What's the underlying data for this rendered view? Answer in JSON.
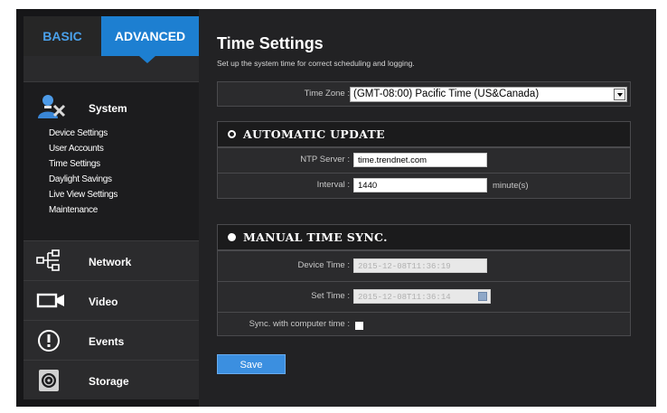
{
  "tabs": {
    "basic": "BASIC",
    "advanced": "ADVANCED"
  },
  "sidebar": {
    "system": {
      "label": "System",
      "items": [
        "Device Settings",
        "User Accounts",
        "Time Settings",
        "Daylight Savings",
        "Live View Settings",
        "Maintenance"
      ]
    },
    "network": "Network",
    "video": "Video",
    "events": "Events",
    "storage": "Storage"
  },
  "page": {
    "title": "Time Settings",
    "description": "Set up the system time for correct scheduling and logging."
  },
  "time_zone": {
    "label": "Time Zone :",
    "value": "(GMT-08:00) Pacific Time (US&Canada)"
  },
  "automatic_update": {
    "title": "AUTOMATIC UPDATE",
    "selected": false,
    "ntp_label": "NTP Server :",
    "ntp_value": "time.trendnet.com",
    "interval_label": "Interval :",
    "interval_value": "1440",
    "interval_unit": "minute(s)"
  },
  "manual_sync": {
    "title": "MANUAL TIME SYNC.",
    "selected": true,
    "device_time_label": "Device Time :",
    "device_time_value": "2015-12-08T11:36:19",
    "set_time_label": "Set Time :",
    "set_time_value": "2015-12-08T11:36:14",
    "sync_label": "Sync. with computer time :",
    "sync_checked": false
  },
  "actions": {
    "save": "Save"
  },
  "colors": {
    "accent": "#1d7fd1",
    "tab_inactive_text": "#4aa0ea",
    "background": "#1f1f21"
  }
}
